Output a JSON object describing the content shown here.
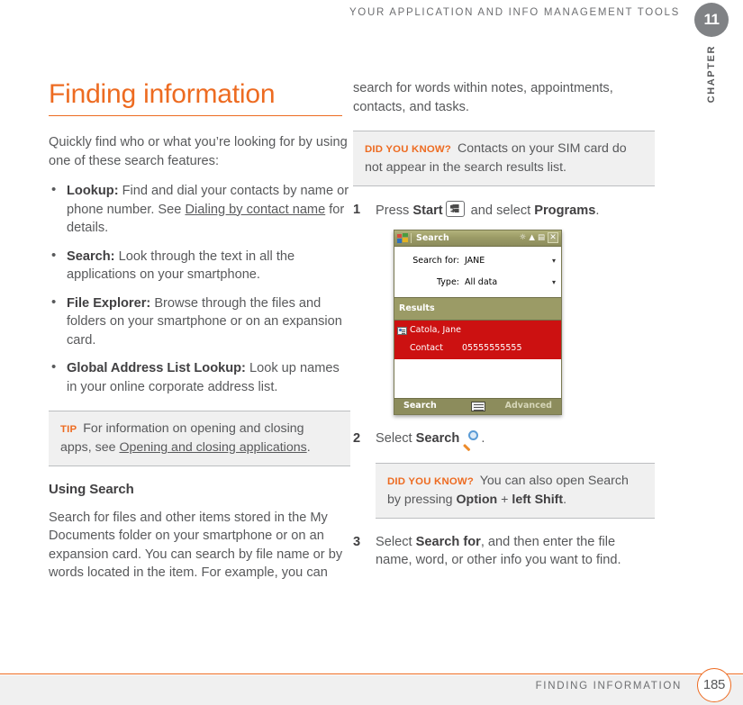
{
  "header": {
    "running_head": "YOUR APPLICATION AND INFO MANAGEMENT TOOLS",
    "chapter_number": "11",
    "chapter_word": "CHAPTER"
  },
  "accent_color": "#ed6b21",
  "left_column": {
    "title": "Finding information",
    "intro": "Quickly find who or what you’re looking for by using one of these search features:",
    "bullets": [
      {
        "term": "Lookup:",
        "text_before": " Find and dial your contacts by name or phone number. See ",
        "xref": "Dialing by contact name",
        "text_after": " for details."
      },
      {
        "term": "Search:",
        "text_before": " Look through the text in all the applications on your smartphone.",
        "xref": "",
        "text_after": ""
      },
      {
        "term": "File Explorer:",
        "text_before": " Browse through the files and folders on your smartphone or on an expansion card.",
        "xref": "",
        "text_after": ""
      },
      {
        "term": "Global Address List Lookup:",
        "text_before": " Look up names in your online corporate address list.",
        "xref": "",
        "text_after": ""
      }
    ],
    "tip": {
      "label": "TIP",
      "text_before": " For information on opening and closing apps, see ",
      "xref": "Opening and closing applications",
      "text_after": "."
    },
    "subhead": "Using Search",
    "paragraph": "Search for files and other items stored in the My Documents folder on your smartphone or on an expansion card. You can search by file name or by words located in the item. For example, you can"
  },
  "right_column": {
    "continued_paragraph": "search for words within notes, appointments, contacts, and tasks.",
    "did_you_know_1": {
      "label": "DID YOU KNOW?",
      "text": " Contacts on your SIM card do not appear in the search results list."
    },
    "steps": [
      {
        "num": "1",
        "pre": "Press ",
        "bold1": "Start",
        "icon": "windows-start-key-icon",
        "mid": " and select ",
        "bold2": "Programs",
        "post": "."
      },
      {
        "num": "2",
        "pre": "Select ",
        "bold1": "Search",
        "icon": "magnifier-icon",
        "mid": "",
        "bold2": "",
        "post": "."
      },
      {
        "num": "3",
        "pre": "Select ",
        "bold1": "Search for",
        "icon": "",
        "mid": ", and then enter the file name, word, or other info you want to find.",
        "bold2": "",
        "post": ""
      }
    ],
    "did_you_know_2": {
      "label": "DID YOU KNOW?",
      "text_before": " You can also open Search by pressing ",
      "bold1": "Option",
      "plus": " + ",
      "bold2": "left Shift",
      "text_after": "."
    }
  },
  "device_screenshot": {
    "title": "Search",
    "window_logo": "windows-logo-icon",
    "system_icons": [
      "volume-icon",
      "signal-icon",
      "connectivity-icon"
    ],
    "close_label": "✕",
    "fields": [
      {
        "label": "Search for:",
        "value": "JANE",
        "caret": "▾"
      },
      {
        "label": "Type:",
        "value": "All data",
        "caret": "▾"
      }
    ],
    "results_header": "Results",
    "result": {
      "name": "Catola, Jane",
      "type": "Contact",
      "number": "05555555555"
    },
    "softkey_left": "Search",
    "softkey_center": "keyboard-icon",
    "softkey_right": "Advanced"
  },
  "footer": {
    "title": "FINDING INFORMATION",
    "page_number": "185"
  }
}
